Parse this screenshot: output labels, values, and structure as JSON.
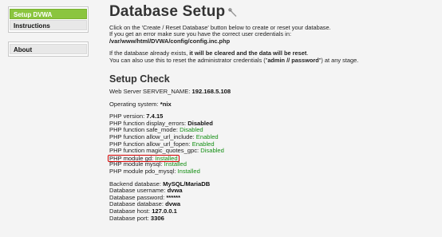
{
  "sidebar": {
    "items": [
      {
        "label": "Setup DVWA",
        "selected": true
      },
      {
        "label": "Instructions",
        "selected": false
      }
    ],
    "about_label": "About"
  },
  "header": {
    "title": "Database Setup",
    "icon": "wrench-icon"
  },
  "intro": {
    "line1": "Click on the 'Create / Reset Database' button below to create or reset your database.",
    "line2": "If you get an error make sure you have the correct user credentials in:",
    "config_path": "/var/www/html/DVWA/config/config.inc.php",
    "line3_prefix": "If the database already exists, ",
    "line3_bold": "it will be cleared and the data will be reset",
    "line3_suffix": ".",
    "line4_prefix": "You can also use this to reset the administrator credentials (\"",
    "line4_bold": "admin // password",
    "line4_suffix": "\") at any stage."
  },
  "setup_check": {
    "title": "Setup Check",
    "server_name_label": "Web Server SERVER_NAME: ",
    "server_name_value": "192.168.5.108",
    "os_label": "Operating system: ",
    "os_value": "*nix",
    "php_version_label": "PHP version: ",
    "php_version_value": "7.4.15",
    "php_rows": [
      {
        "label": "PHP function display_errors: ",
        "value": "Disabled",
        "status": "bold"
      },
      {
        "label": "PHP function safe_mode: ",
        "value": "Disabled",
        "status": "ok"
      },
      {
        "label": "PHP function allow_url_include: ",
        "value": "Enabled",
        "status": "ok"
      },
      {
        "label": "PHP function allow_url_fopen: ",
        "value": "Enabled",
        "status": "ok"
      },
      {
        "label": "PHP function magic_quotes_gpc: ",
        "value": "Disabled",
        "status": "ok"
      },
      {
        "label": "PHP module gd: ",
        "value": "Installed",
        "status": "ok"
      },
      {
        "label": "PHP module mysql: ",
        "value": "Installed",
        "status": "ok"
      },
      {
        "label": "PHP module pdo_mysql: ",
        "value": "Installed",
        "status": "ok"
      }
    ],
    "db_rows": [
      {
        "label": "Backend database: ",
        "value": "MySQL/MariaDB"
      },
      {
        "label": "Database username: ",
        "value": "dvwa"
      },
      {
        "label": "Database password: ",
        "value": "******"
      },
      {
        "label": "Database database: ",
        "value": "dvwa"
      },
      {
        "label": "Database host: ",
        "value": "127.0.0.1"
      },
      {
        "label": "Database port: ",
        "value": "3306"
      }
    ]
  },
  "colors": {
    "menu_selected": "#8bc53f",
    "ok": "#148f14",
    "highlight_border": "#d40000"
  }
}
